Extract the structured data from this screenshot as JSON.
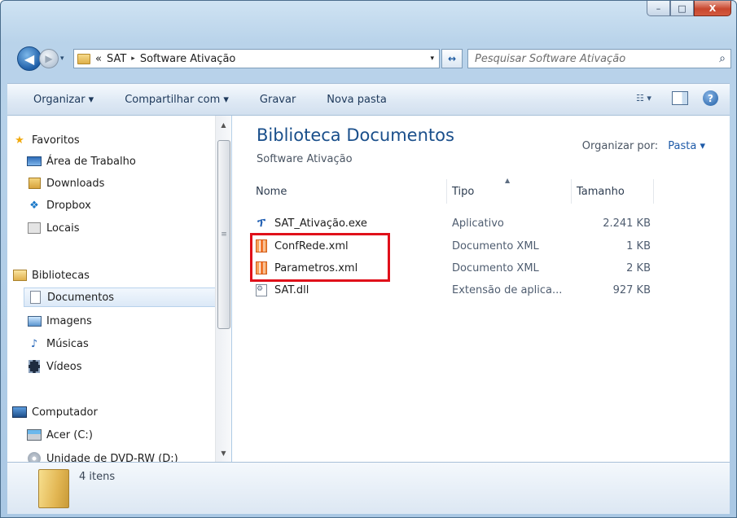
{
  "window": {
    "caption": {
      "min": "–",
      "max": "□",
      "close": "X"
    }
  },
  "address_bar": {
    "overflow": "«",
    "breadcrumb": [
      "SAT",
      "Software Ativação"
    ],
    "separator": "▸",
    "dropdown": "▾"
  },
  "nav_buttons": {
    "back": "◀",
    "forward": "▶",
    "history": "▾",
    "refresh": "↔"
  },
  "search": {
    "placeholder": "Pesquisar Software Ativação",
    "icon": "search-icon"
  },
  "toolbar": {
    "items": [
      "Organizar ▾",
      "Compartilhar com ▾",
      "Gravar",
      "Nova pasta"
    ],
    "views_label": "☷ ▾",
    "help": "?"
  },
  "nav_pane": {
    "favorites_title": "Favoritos",
    "favorites": [
      "Área de Trabalho",
      "Downloads",
      "Dropbox",
      "Locais"
    ],
    "libraries_title": "Bibliotecas",
    "libraries": [
      "Documentos",
      "Imagens",
      "Músicas",
      "Vídeos"
    ],
    "computer_title": "Computador",
    "drives": [
      "Acer (C:)",
      "Unidade de DVD-RW (D:)"
    ],
    "selected": "Documentos"
  },
  "content": {
    "library_title": "Biblioteca Documentos",
    "library_subtitle": "Software Ativação",
    "arrange_label": "Organizar por:",
    "arrange_value": "Pasta ▾",
    "columns": [
      "Nome",
      "Tipo",
      "Tamanho"
    ],
    "sort_indicator": "▲",
    "files": [
      {
        "name": "SAT_Ativação.exe",
        "type": "Aplicativo",
        "size": "2.241 KB",
        "icon": "exe-icon"
      },
      {
        "name": "ConfRede.xml",
        "type": "Documento XML",
        "size": "1 KB",
        "icon": "xml-icon"
      },
      {
        "name": "Parametros.xml",
        "type": "Documento XML",
        "size": "2 KB",
        "icon": "xml-icon"
      },
      {
        "name": "SAT.dll",
        "type": "Extensão de aplica...",
        "size": "927 KB",
        "icon": "dll-icon"
      }
    ],
    "highlight_color": "#e0101a"
  },
  "status": {
    "count": "4 itens"
  },
  "scroll": {
    "up": "▲",
    "down": "▼",
    "grip": "≡"
  }
}
